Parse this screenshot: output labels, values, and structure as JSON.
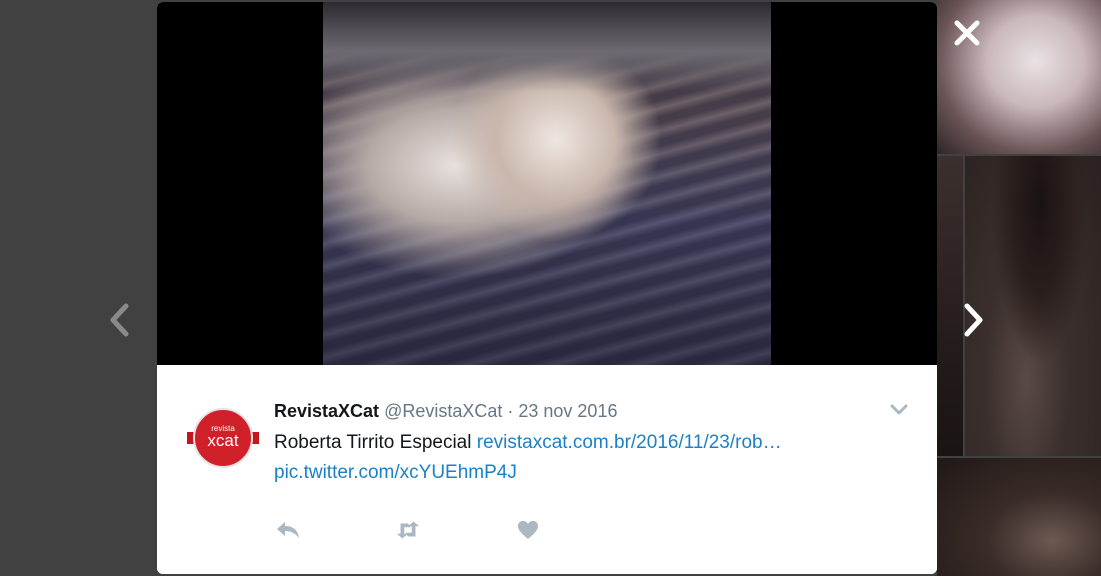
{
  "gallery": {
    "thumbnails": [
      "thumb-1",
      "thumb-2",
      "thumb-3",
      "thumb-4"
    ]
  },
  "controls": {
    "close_icon": "close-icon",
    "prev_icon": "chevron-left-icon",
    "next_icon": "chevron-right-icon"
  },
  "tweet": {
    "author_name": "RevistaXCat",
    "handle": "@RevistaXCat",
    "separator": " · ",
    "date": "23 nov 2016",
    "text": "Roberta Tirrito Especial ",
    "link": "revistaxcat.com.br/2016/11/23/rob…",
    "pic_link": "pic.twitter.com/xcYUEhmP4J",
    "avatar_logo_small": "revista",
    "avatar_logo_main": "xcat"
  },
  "actions": {
    "reply_icon": "reply-icon",
    "retweet_icon": "retweet-icon",
    "like_icon": "heart-icon"
  },
  "colors": {
    "link": "#1b81c6",
    "muted": "#657786",
    "icon": "#aab8c2",
    "logo_red": "#d0202a"
  }
}
